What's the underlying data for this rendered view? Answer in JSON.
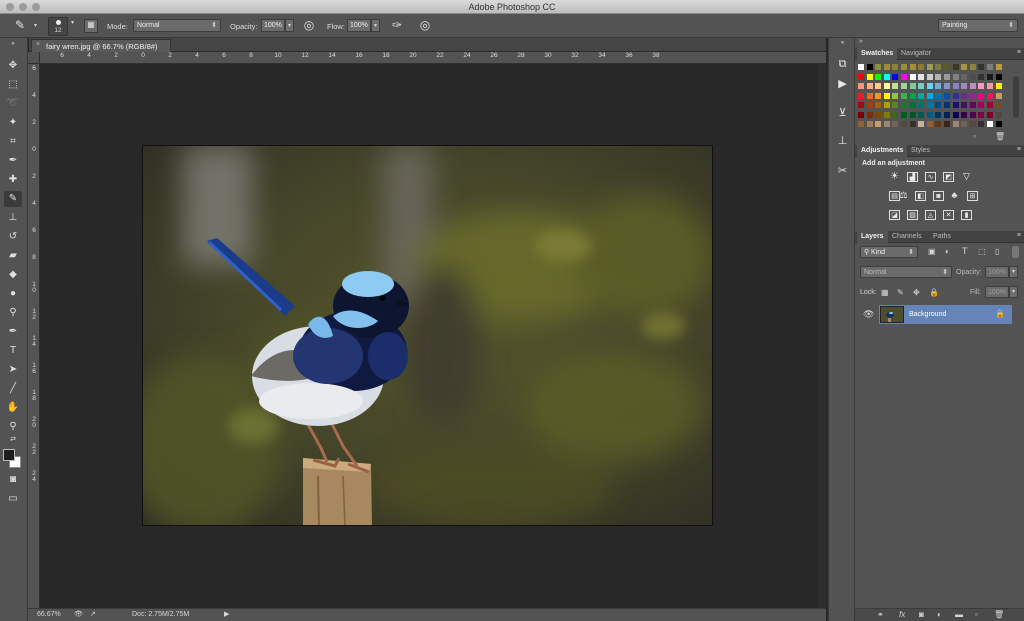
{
  "app": {
    "title": "Adobe Photoshop CC"
  },
  "options": {
    "brush_size": "12",
    "mode_label": "Mode:",
    "mode_value": "Normal",
    "opacity_label": "Opacity:",
    "opacity_value": "100%",
    "flow_label": "Flow:",
    "flow_value": "100%",
    "workspace": "Painting"
  },
  "document": {
    "tab_title": "fairy wren.jpg @ 66.7% (RGB/8#)",
    "close_glyph": "×"
  },
  "rulers": {
    "h": [
      "6",
      "4",
      "2",
      "0",
      "2",
      "4",
      "6",
      "8",
      "10",
      "12",
      "14",
      "16",
      "18",
      "20",
      "22",
      "24",
      "26",
      "28",
      "30",
      "32",
      "34",
      "36",
      "38"
    ],
    "v": [
      "6",
      "4",
      "2",
      "0",
      "2",
      "4",
      "6",
      "8",
      "1\n0",
      "1\n2",
      "1\n4",
      "1\n6",
      "1\n8",
      "2\n0",
      "2\n2",
      "2\n4"
    ]
  },
  "status": {
    "zoom": "66.67%",
    "doc": "Doc: 2.75M/2.75M"
  },
  "panels": {
    "swatches_tab": "Swatches",
    "navigator_tab": "Navigator",
    "adjustments_tab": "Adjustments",
    "styles_tab": "Styles",
    "adjustments_heading": "Add an adjustment",
    "layers_tab": "Layers",
    "channels_tab": "Channels",
    "paths_tab": "Paths",
    "kind_label": "Kind",
    "blend_mode": "Normal",
    "opacity_label": "Opacity:",
    "opacity_value": "100%",
    "lock_label": "Lock:",
    "fill_label": "Fill:",
    "fill_value": "100%",
    "layer_name": "Background"
  },
  "colors": {
    "accent_layer": "#6584b8",
    "fg": "#1e1e1e",
    "bg": "#ffffff"
  }
}
